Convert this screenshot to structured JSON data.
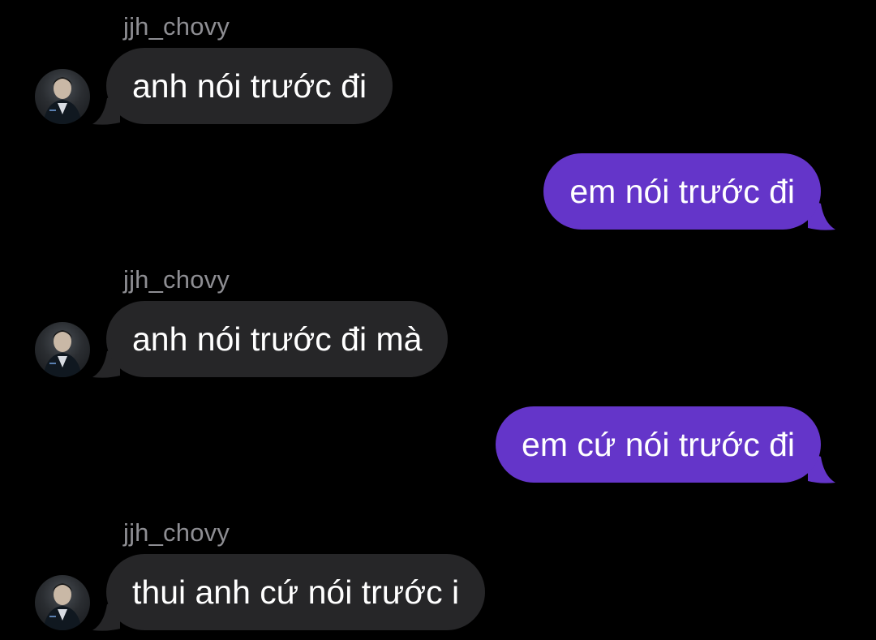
{
  "thread": {
    "messages": [
      {
        "direction": "incoming",
        "sender": "jjh_chovy",
        "text": "anh nói trước đi"
      },
      {
        "direction": "outgoing",
        "text": "em nói trước đi"
      },
      {
        "direction": "incoming",
        "sender": "jjh_chovy",
        "text": "anh nói trước đi mà"
      },
      {
        "direction": "outgoing",
        "text": "em cứ nói trước đi"
      },
      {
        "direction": "incoming",
        "sender": "jjh_chovy",
        "text": "thui anh cứ nói trước i"
      }
    ]
  },
  "colors": {
    "background": "#000000",
    "incoming_bubble": "#262628",
    "outgoing_bubble": "#6435c9",
    "sender_name": "#8e8e93",
    "text": "#ffffff"
  },
  "icons": {
    "avatar": "profile-photo-avatar"
  }
}
